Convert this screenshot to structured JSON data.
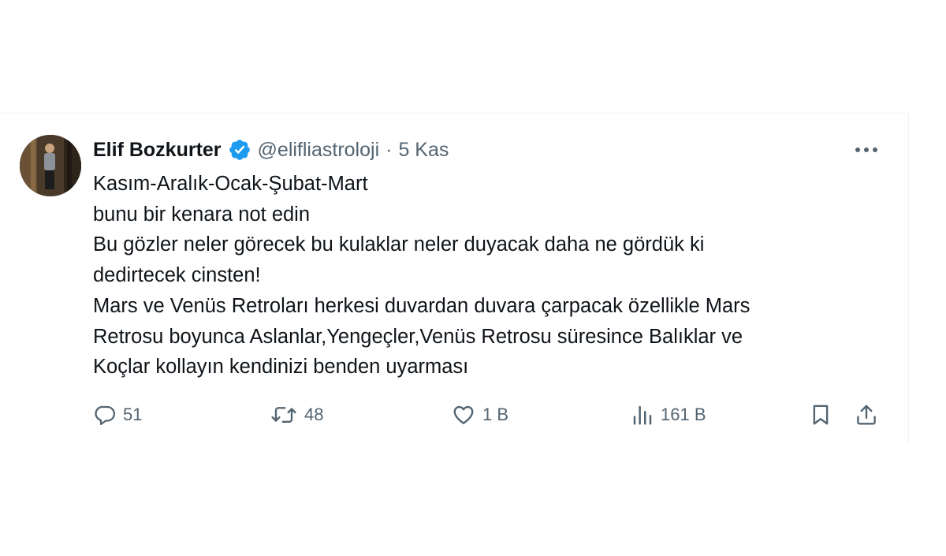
{
  "tweet": {
    "author_name": "Elif Bozkurter",
    "handle": "@elifliastroloji",
    "separator": "·",
    "date": "5 Kas",
    "body_lines": [
      "Kasım-Aralık-Ocak-Şubat-Mart",
      "bunu bir kenara not edin",
      "Bu gözler neler görecek bu kulaklar neler duyacak daha ne gördük ki",
      "dedirtecek cinsten!",
      "Mars ve Venüs Retroları herkesi duvardan duvara çarpacak özellikle Mars",
      "Retrosu boyunca Aslanlar,Yengeçler,Venüs Retrosu süresince Balıklar ve",
      "Koçlar kollayın kendinizi benden uyarması"
    ],
    "stats": {
      "replies": "51",
      "reposts": "48",
      "likes": "1 B",
      "views": "161 B"
    }
  },
  "icons": {
    "verified": "verified-badge-icon",
    "more": "more-horizontal-icon",
    "reply": "reply-icon",
    "repost": "repost-icon",
    "like": "heart-icon",
    "views": "views-chart-icon",
    "bookmark": "bookmark-icon",
    "share": "share-icon"
  },
  "colors": {
    "verified_blue": "#1d9bf0",
    "text_primary": "#0f1419",
    "text_secondary": "#536471",
    "border": "#eff3f4"
  }
}
